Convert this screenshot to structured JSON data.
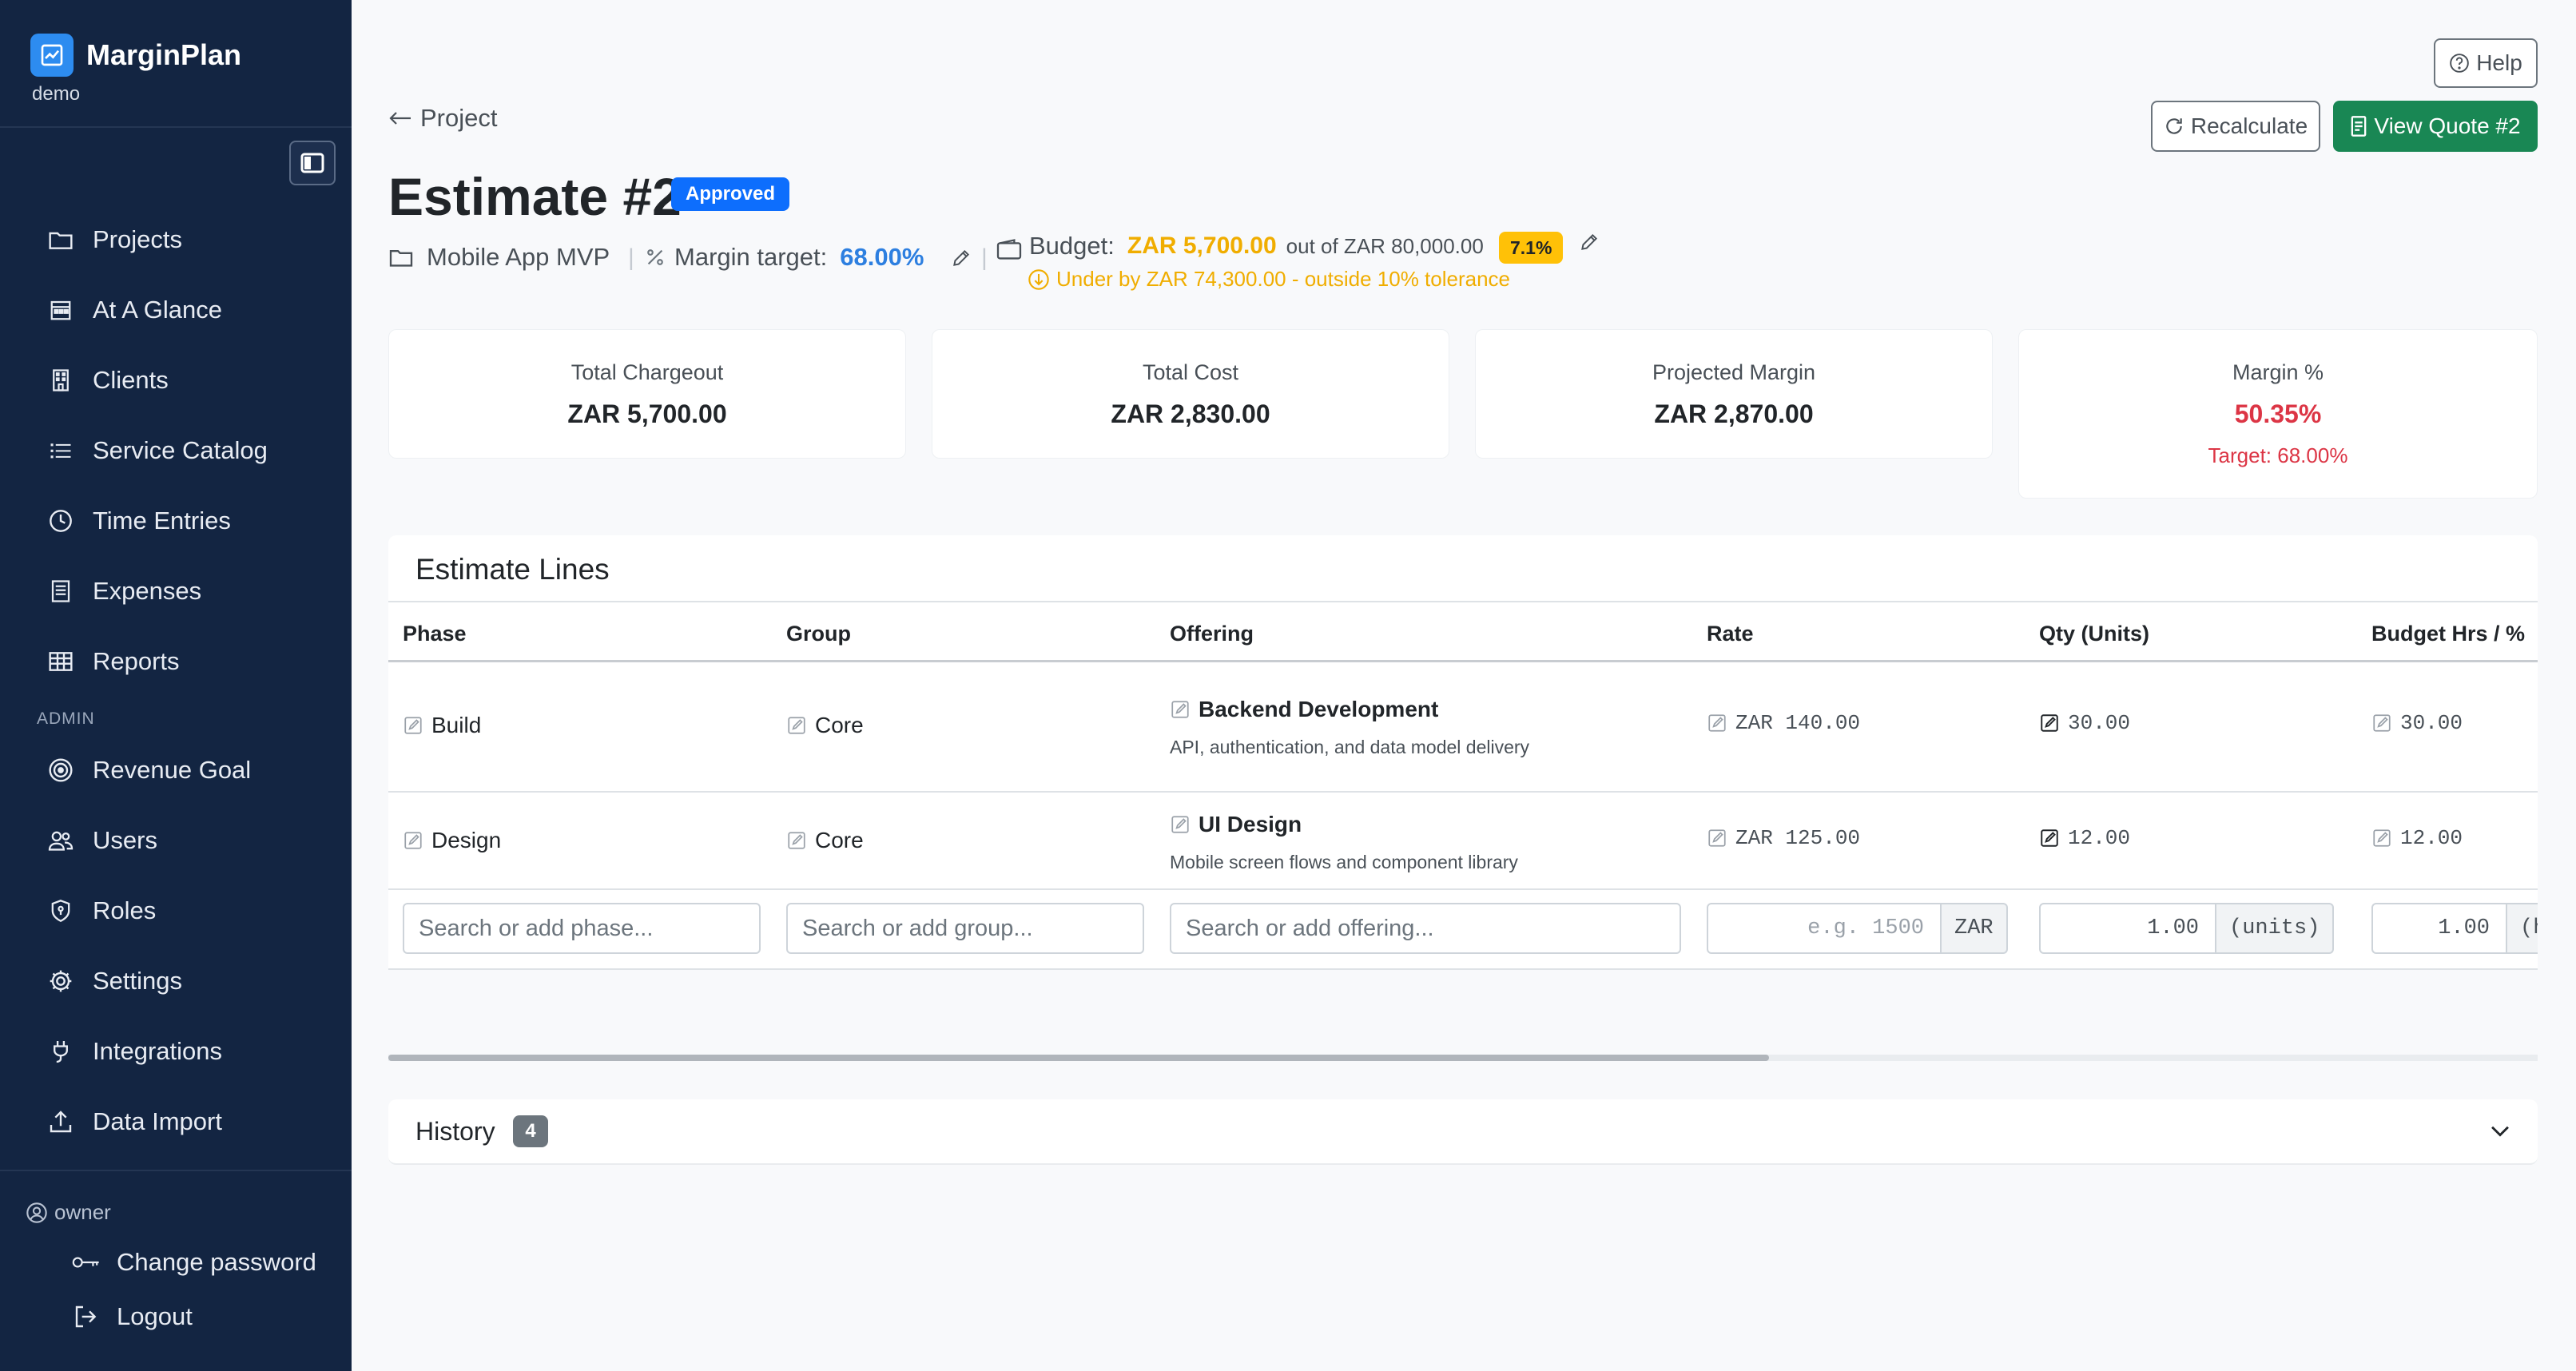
{
  "app": {
    "name": "MarginPlan",
    "tenant": "demo",
    "brand_color": "#2d8cf0",
    "sidebar_bg": "#132542"
  },
  "sidebar": {
    "items": [
      {
        "label": "Projects",
        "icon": "folder-icon"
      },
      {
        "label": "At A Glance",
        "icon": "calendar-icon"
      },
      {
        "label": "Clients",
        "icon": "building-icon"
      },
      {
        "label": "Service Catalog",
        "icon": "list-icon"
      },
      {
        "label": "Time Entries",
        "icon": "clock-icon"
      },
      {
        "label": "Expenses",
        "icon": "receipt-icon"
      },
      {
        "label": "Reports",
        "icon": "table-icon"
      }
    ],
    "admin_label": "ADMIN",
    "admin_items": [
      {
        "label": "Revenue Goal",
        "icon": "target-icon"
      },
      {
        "label": "Users",
        "icon": "users-icon"
      },
      {
        "label": "Roles",
        "icon": "shield-icon"
      },
      {
        "label": "Settings",
        "icon": "gear-icon"
      },
      {
        "label": "Integrations",
        "icon": "plug-icon"
      },
      {
        "label": "Data Import",
        "icon": "upload-icon"
      }
    ],
    "user": "owner",
    "change_password": "Change password",
    "logout": "Logout"
  },
  "header": {
    "help": "Help",
    "back": "Project",
    "title": "Estimate #2",
    "status": "Approved",
    "recalculate": "Recalculate",
    "view_quote": "View Quote #2",
    "project_name": "Mobile App MVP",
    "margin_label": "Margin target:",
    "margin_value": "68.00%",
    "budget_label": "Budget:",
    "budget_value": "ZAR 5,700.00",
    "budget_out_of": "out of ZAR 80,000.00",
    "budget_pct": "7.1%",
    "tolerance_msg": "Under by ZAR 74,300.00 - outside 10% tolerance"
  },
  "stats": [
    {
      "label": "Total Chargeout",
      "value": "ZAR 5,700.00"
    },
    {
      "label": "Total Cost",
      "value": "ZAR 2,830.00"
    },
    {
      "label": "Projected Margin",
      "value": "ZAR 2,870.00"
    },
    {
      "label": "Margin %",
      "value": "50.35%",
      "target": "Target: 68.00%"
    }
  ],
  "lines": {
    "title": "Estimate Lines",
    "columns": [
      "Phase",
      "Group",
      "Offering",
      "Rate",
      "Qty (Units)",
      "Budget Hrs / %"
    ],
    "rows": [
      {
        "phase": "Build",
        "group": "Core",
        "offering": "Backend Development",
        "description": "API, authentication, and data model delivery",
        "rate": "ZAR 140.00",
        "qty": "30.00",
        "hours": "30.00"
      },
      {
        "phase": "Design",
        "group": "Core",
        "offering": "UI Design",
        "description": "Mobile screen flows and component library",
        "rate": "ZAR 125.00",
        "qty": "12.00",
        "hours": "12.00"
      }
    ],
    "new_row": {
      "phase_placeholder": "Search or add phase...",
      "group_placeholder": "Search or add group...",
      "offering_placeholder": "Search or add offering...",
      "rate_placeholder": "e.g. 1500",
      "rate_addon": "ZAR",
      "qty_value": "1.00",
      "qty_addon": "(units)",
      "hours_value": "1.00",
      "hours_addon": "(h"
    }
  },
  "history": {
    "label": "History",
    "count": "4"
  }
}
